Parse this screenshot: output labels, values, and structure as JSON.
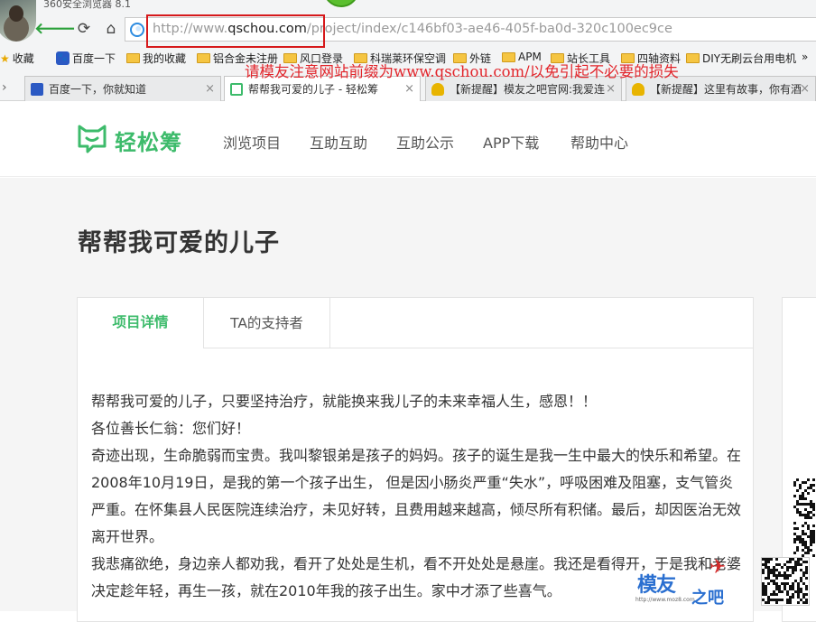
{
  "browser": {
    "app_title": "360安全浏览器 8.1",
    "address": {
      "prefix": "http://www.",
      "domain": "qschou.com",
      "suffix": "/project/index/c146bf03-ae46-405f-ba0d-320c100ec9ce"
    },
    "nav_icons": [
      "back-icon",
      "refresh-icon",
      "home-icon"
    ],
    "bookmarks": [
      {
        "label": "收藏",
        "icon": "star-icon"
      },
      {
        "label": "百度一下",
        "icon": "paw-icon"
      },
      {
        "label": "我的收藏",
        "icon": "folder-icon"
      },
      {
        "label": "铝合金未注册",
        "icon": "folder-icon"
      },
      {
        "label": "风口登录",
        "icon": "folder-icon"
      },
      {
        "label": "科瑞莱环保空调",
        "icon": "folder-icon"
      },
      {
        "label": "外链",
        "icon": "folder-icon"
      },
      {
        "label": "APM",
        "icon": "folder-icon"
      },
      {
        "label": "站长工具",
        "icon": "folder-icon"
      },
      {
        "label": "四轴资料",
        "icon": "folder-icon"
      },
      {
        "label": "DIY无刷云台用电机",
        "icon": "folder-icon"
      }
    ],
    "bookmarks_more": "»",
    "tabs": [
      {
        "label": "百度一下，你就知道",
        "icon": "paw-icon",
        "active": false
      },
      {
        "label": "帮帮我可爱的儿子 - 轻松筹",
        "icon": "qsc-icon",
        "active": true
      },
      {
        "label": "【新提醒】模友之吧官网:我爱连",
        "icon": "trophy-icon",
        "active": false
      },
      {
        "label": "【新提醒】这里有故事，你有酒",
        "icon": "trophy-icon",
        "active": false
      }
    ],
    "close_glyph": "×"
  },
  "overlay_notice": "请模友注意网站前缀为www.qschou.com/以免引起不必要的损失",
  "site": {
    "logo_text": "轻松筹",
    "brand_color": "#3dbb6b",
    "nav": [
      "浏览项目",
      "互助互助",
      "互助公示",
      "APP下载",
      "帮助中心"
    ]
  },
  "project": {
    "title": "帮帮我可爱的儿子",
    "tabs": {
      "detail": "项目详情",
      "supporters": "TA的支持者"
    },
    "story": [
      "帮帮我可爱的儿子，只要坚持治疗，就能换来我儿子的未来幸福人生，感恩！！",
      "各位善长仁翁：您们好！",
      "奇迹出现，生命脆弱而宝贵。我叫黎银弟是孩子的妈妈。孩子的诞生是我一生中最大的快乐和希望。在2008年10月19日，是我的第一个孩子出生， 但是因小肠炎严重“失水”，呼吸困难及阻塞，支气管炎严重。在怀集县人民医院连续治疗，未见好转，且费用越来越高，倾尽所有积储。最后，却因医治无效离开世界。",
      "我悲痛欲绝，身边亲人都劝我，看开了处处是生机，看不开处处是悬崖。我还是看得开，于是我和老婆决定趁年轻，再生一孩，就在2010年我的孩子出生。家中才添了些喜气。"
    ]
  },
  "watermark": {
    "text": "模友",
    "text2": "之吧",
    "url": "http://www.moz8.com"
  }
}
